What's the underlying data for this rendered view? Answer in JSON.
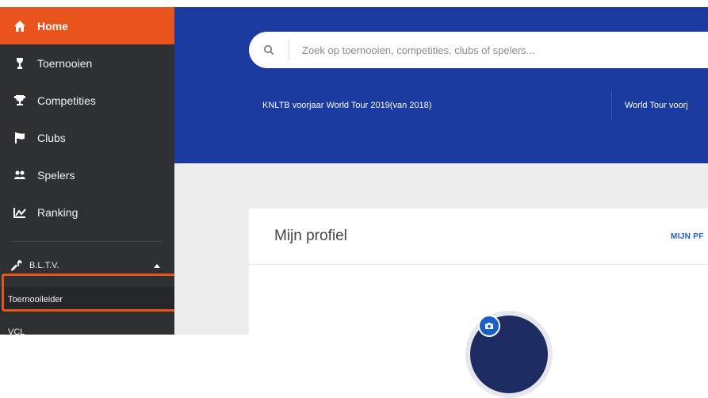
{
  "sidebar": {
    "items": [
      {
        "label": "Home",
        "icon": "home-icon",
        "active": true
      },
      {
        "label": "Toernooien",
        "icon": "trophy-cup-icon"
      },
      {
        "label": "Competities",
        "icon": "cup-icon"
      },
      {
        "label": "Clubs",
        "icon": "flag-icon"
      },
      {
        "label": "Spelers",
        "icon": "users-icon"
      },
      {
        "label": "Ranking",
        "icon": "chart-line-icon"
      }
    ],
    "group": {
      "label": "B.L.T.V.",
      "icon": "wrench-icon"
    },
    "sub_items": [
      {
        "label": "Toernooileider"
      },
      {
        "label": "VCL"
      }
    ]
  },
  "search": {
    "placeholder": "Zoek op toernooien, competities, clubs of spelers..."
  },
  "tournaments": {
    "first": "KNLTB voorjaar World Tour 2019(van 2018)",
    "second": "World Tour voorj"
  },
  "profile_card": {
    "title": "Mijn profiel",
    "link": "MIJN PF"
  },
  "colors": {
    "accent": "#e8541c",
    "sidebar_bg": "#2e3032",
    "header_bg": "#1a3a9f",
    "link": "#1a5fc8"
  }
}
